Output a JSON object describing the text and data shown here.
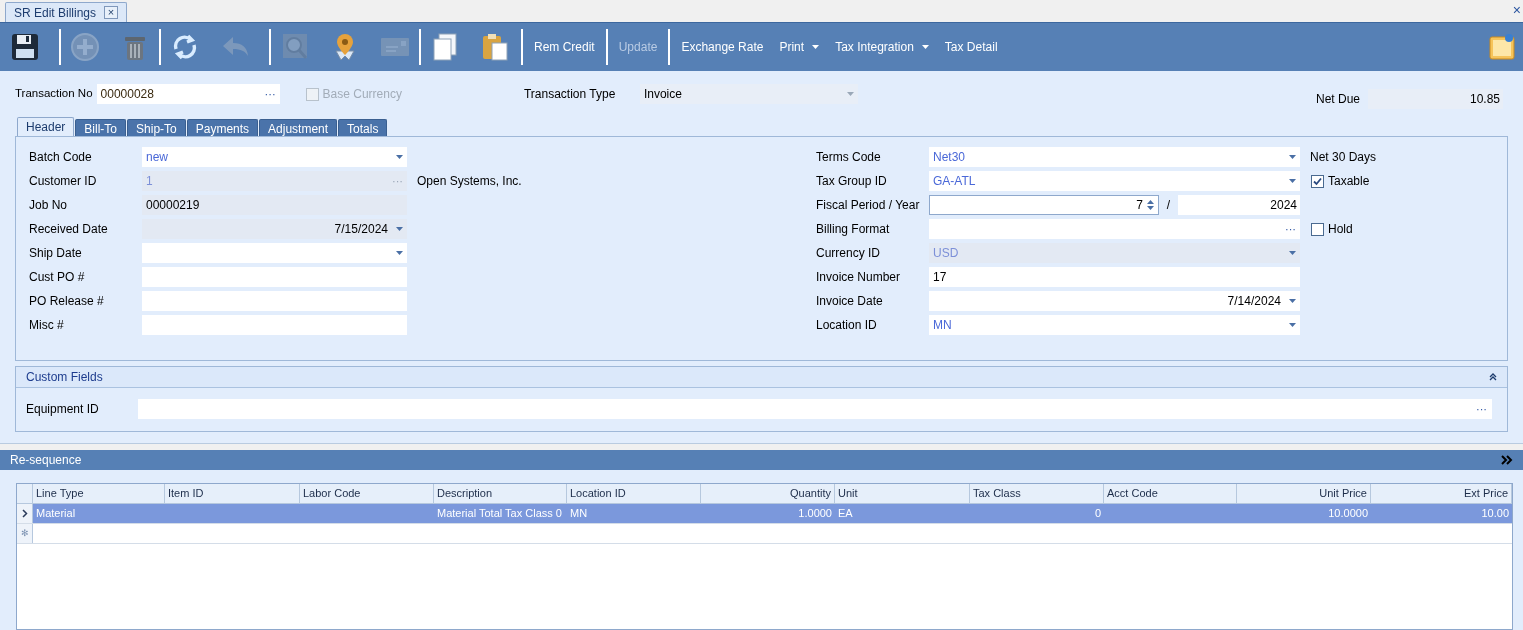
{
  "doc_tab": {
    "title": "SR Edit Billings",
    "close": "×"
  },
  "window_close": "×",
  "toolbar": {
    "icon_buttons": [
      {
        "kind": "save",
        "disabled": false
      },
      {
        "kind": "add",
        "disabled": true
      },
      {
        "kind": "delete",
        "disabled": false
      },
      {
        "kind": "refresh",
        "disabled": false
      },
      {
        "kind": "undo",
        "disabled": true
      },
      {
        "kind": "search",
        "disabled": true
      },
      {
        "kind": "pin",
        "disabled": false
      },
      {
        "kind": "card",
        "disabled": true
      },
      {
        "kind": "copy",
        "disabled": false
      },
      {
        "kind": "paste",
        "disabled": false
      }
    ],
    "text_buttons": [
      {
        "label": "Rem Credit",
        "disabled": false,
        "dropdown": false,
        "separator": true
      },
      {
        "label": "Update",
        "disabled": true,
        "dropdown": false,
        "separator": true
      },
      {
        "label": "Exchange Rate",
        "disabled": false,
        "dropdown": false,
        "separator": false
      },
      {
        "label": "Print",
        "disabled": false,
        "dropdown": true,
        "separator": false
      },
      {
        "label": "Tax Integration",
        "disabled": false,
        "dropdown": true,
        "separator": false
      },
      {
        "label": "Tax Detail",
        "disabled": false,
        "dropdown": false,
        "separator": false
      }
    ]
  },
  "top": {
    "transaction_no": {
      "label": "Transaction No",
      "value": "00000028",
      "button": "···"
    },
    "base_currency": {
      "label": "Base Currency",
      "checked": false,
      "disabled": true
    },
    "transaction_type": {
      "label": "Transaction Type",
      "value": "Invoice"
    },
    "net_due": {
      "label": "Net Due",
      "value": "10.85"
    }
  },
  "tabs": [
    {
      "label": "Header",
      "selected": true
    },
    {
      "label": "Bill-To",
      "selected": false
    },
    {
      "label": "Ship-To",
      "selected": false
    },
    {
      "label": "Payments",
      "selected": false
    },
    {
      "label": "Adjustment",
      "selected": false
    },
    {
      "label": "Totals",
      "selected": false
    }
  ],
  "left_fields": [
    {
      "label": "Batch Code",
      "kind": "dropdown",
      "value": "new",
      "readonly": false
    },
    {
      "label": "Customer ID",
      "kind": "lookup",
      "value": "1",
      "button": "···",
      "readonly": true,
      "note": "Open Systems, Inc."
    },
    {
      "label": "Job No",
      "kind": "text",
      "value": "00000219",
      "readonly": true
    },
    {
      "label": "Received Date",
      "kind": "date",
      "value": "7/15/2024",
      "readonly": true
    },
    {
      "label": "Ship Date",
      "kind": "date",
      "readonly": false
    },
    {
      "label": "Cust PO #",
      "kind": "text",
      "readonly": false
    },
    {
      "label": "PO Release #",
      "kind": "text",
      "readonly": false
    },
    {
      "label": "Misc #",
      "kind": "text",
      "readonly": false
    }
  ],
  "right_fields": [
    {
      "label": "Terms Code",
      "kind": "dropdown",
      "value": "Net30",
      "readonly": false,
      "side": {
        "kind": "text",
        "label": "Net 30 Days"
      }
    },
    {
      "label": "Tax Group ID",
      "kind": "dropdown",
      "value": "GA-ATL",
      "readonly": false,
      "side": {
        "kind": "checkbox",
        "label": "Taxable",
        "checked": true
      }
    },
    {
      "label": "Fiscal Period / Year",
      "kind": "period",
      "value": "7",
      "separator": "/",
      "year": "2024"
    },
    {
      "label": "Billing Format",
      "kind": "lookup",
      "button": "···",
      "readonly": false,
      "side": {
        "kind": "checkbox",
        "label": "Hold",
        "checked": false
      }
    },
    {
      "label": "Currency ID",
      "kind": "dropdown",
      "value": "USD",
      "readonly": true
    },
    {
      "label": "Invoice Number",
      "kind": "text",
      "value": "17",
      "readonly": false
    },
    {
      "label": "Invoice Date",
      "kind": "date",
      "value": "7/14/2024",
      "readonly": false
    },
    {
      "label": "Location ID",
      "kind": "dropdown",
      "value": "MN",
      "readonly": false
    }
  ],
  "custom_fields": {
    "title": "Custom Fields",
    "expanded": true,
    "fields": [
      {
        "label": "Equipment ID",
        "button": "···"
      }
    ]
  },
  "resequence": {
    "title": "Re-sequence"
  },
  "grid": {
    "columns": [
      "Line Type",
      "Item ID",
      "Labor Code",
      "Description",
      "Location ID",
      "Quantity",
      "Unit",
      "Tax Class",
      "Acct Code",
      "Unit Price",
      "Ext Price"
    ],
    "rows": [
      {
        "selected": true,
        "cells": [
          "Material",
          "",
          "",
          "Material Total Tax Class 0",
          "MN",
          "1.0000",
          "EA",
          "0",
          "",
          "10.0000",
          "10.00"
        ]
      }
    ],
    "new_row_marker": "✻"
  }
}
